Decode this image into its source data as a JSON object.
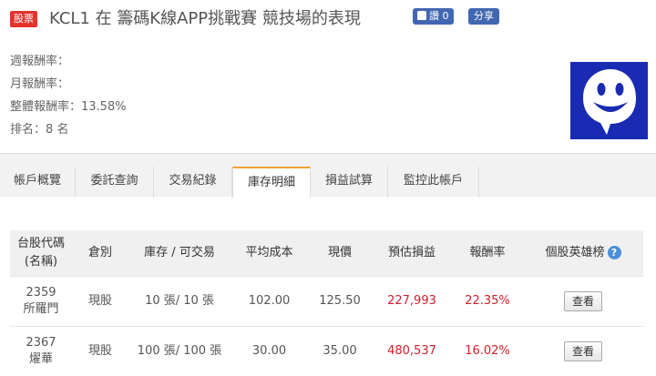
{
  "header": {
    "badge": "股票",
    "title": "KCL1 在 籌碼K線APP挑戰賽 競技場的表現",
    "like_label": "讚 0",
    "share_label": "分享"
  },
  "stats": {
    "weekly": "週報酬率：",
    "monthly": "月報酬率：",
    "total": "整體報酬率：13.58%",
    "rank": "排名：8 名"
  },
  "tabs": [
    {
      "label": "帳戶概覽"
    },
    {
      "label": "委託查詢"
    },
    {
      "label": "交易紀錄"
    },
    {
      "label": "庫存明細"
    },
    {
      "label": "損益試算"
    },
    {
      "label": "監控此帳戶"
    }
  ],
  "table": {
    "headers": [
      "台股代碼",
      "(名稱)",
      "倉別",
      "庫存 / 可交易",
      "平均成本",
      "現價",
      "預估損益",
      "報酬率",
      "個股英雄榜"
    ],
    "rows": [
      {
        "code": "2359",
        "name": "所羅門",
        "type": "現股",
        "qty": "10 張/ 10 張",
        "avg_cost": "102.00",
        "price": "125.50",
        "pnl": "227,993",
        "ret": "22.35%",
        "btn": "查看"
      },
      {
        "code": "2367",
        "name": "燿華",
        "type": "現股",
        "qty": "100 張/ 100 張",
        "avg_cost": "30.00",
        "price": "35.00",
        "pnl": "480,537",
        "ret": "16.02%",
        "btn": "查看"
      }
    ]
  },
  "colors": {
    "accent_red": "#d0202a",
    "badge_red": "#e5322d",
    "fb_blue": "#4267b2",
    "tab_active_border": "#f0a030",
    "avatar_bg": "#1a2bb3"
  },
  "icons": {
    "avatar": "smiley-face-icon",
    "help": "question-circle-icon",
    "like": "thumbs-up-icon"
  }
}
